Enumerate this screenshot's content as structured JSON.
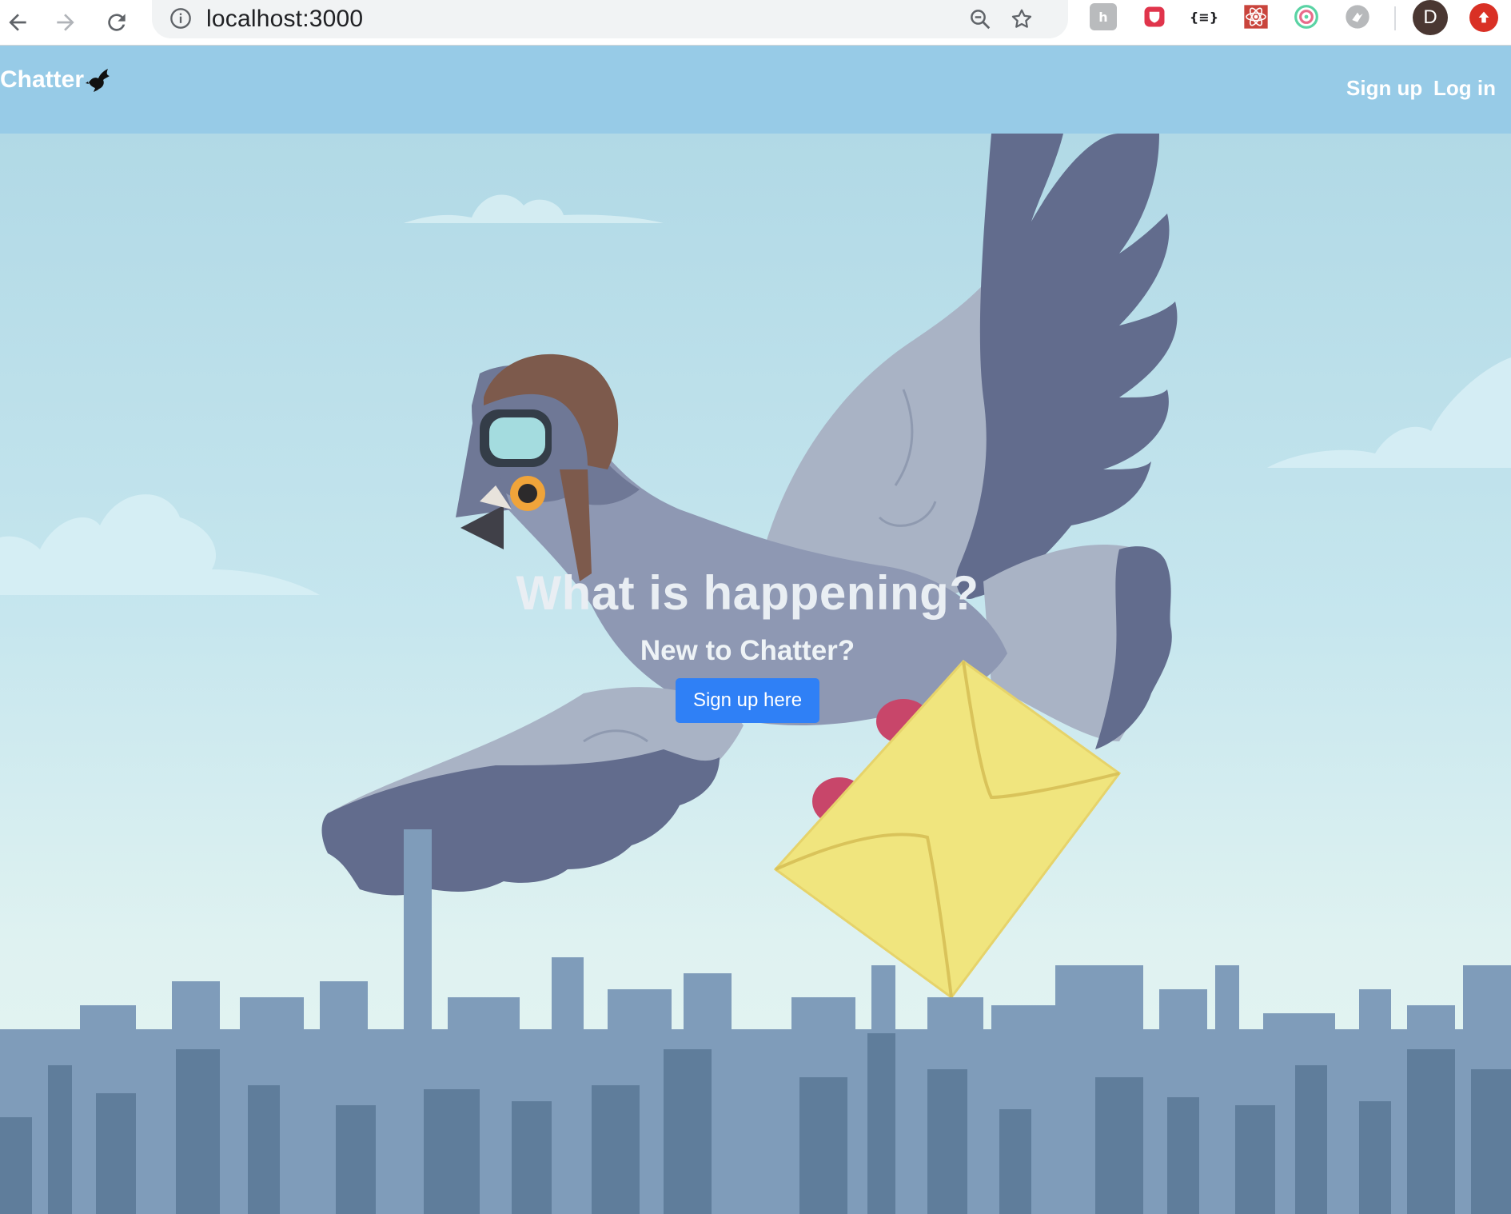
{
  "browser": {
    "url": "localhost:3000",
    "avatar_letter": "D",
    "extension_json_label": "{≡}"
  },
  "site": {
    "brand": "Chatter",
    "nav": {
      "signup": "Sign up",
      "login": "Log in"
    }
  },
  "hero": {
    "headline": "What is happening?",
    "subheadline": "New to Chatter?",
    "cta_label": "Sign up here"
  },
  "colors": {
    "navbar": "#97cbe7",
    "cta": "#2f80f6",
    "sky_top": "#b1d9e6",
    "pigeon_wing": "#636b8b",
    "envelope": "#f0e57e"
  }
}
